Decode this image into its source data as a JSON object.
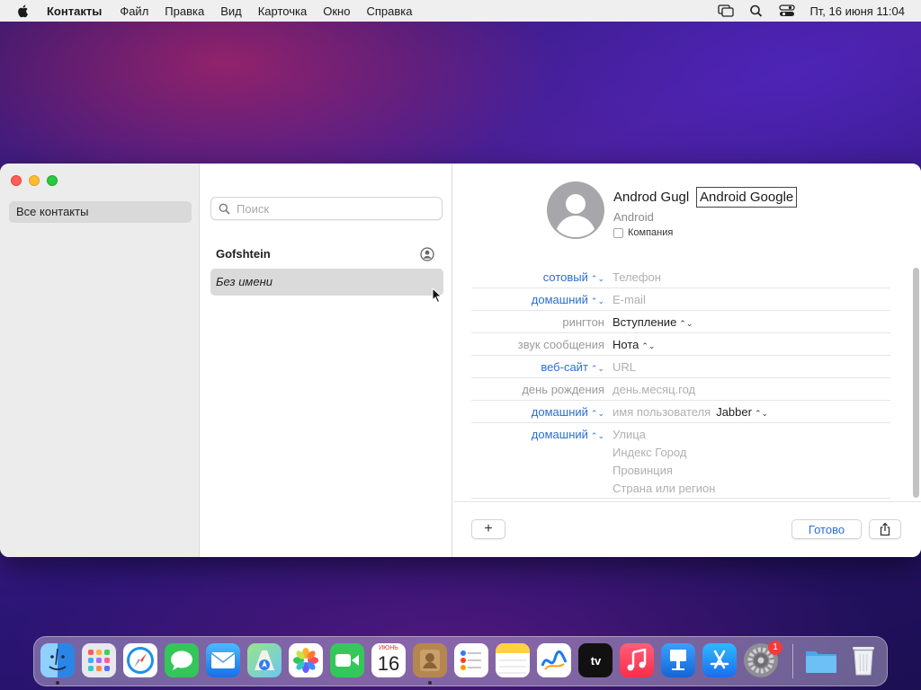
{
  "menubar": {
    "app_name": "Контакты",
    "items": [
      "Файл",
      "Правка",
      "Вид",
      "Карточка",
      "Окно",
      "Справка"
    ],
    "clock": "Пт, 16 июня  11:04"
  },
  "sidebar": {
    "items": [
      {
        "label": "Все контакты"
      }
    ]
  },
  "contact_list": {
    "search_placeholder": "Поиск",
    "rows": [
      {
        "name": "Gofshtein"
      },
      {
        "name": "Без имени"
      }
    ]
  },
  "card": {
    "first_name": "Androd Gugl",
    "name_field_value": "Android Google",
    "company_line": "Android",
    "company_checkbox_label": "Компания",
    "fields": [
      {
        "label": "сотовый",
        "value": "Телефон"
      },
      {
        "label": "домашний",
        "value": "E-mail"
      },
      {
        "label": "рингтон",
        "value": "Вступление"
      },
      {
        "label": "звук сообщения",
        "value": "Нота"
      },
      {
        "label": "веб-сайт",
        "value": "URL"
      },
      {
        "label": "день рождения",
        "value": "день.месяц.год"
      },
      {
        "label": "домашний",
        "value": "имя пользователя",
        "service": "Jabber"
      },
      {
        "label": "домашний",
        "lines": [
          "Улица",
          "Индекс Город",
          "Провинция",
          "Страна или регион"
        ]
      }
    ],
    "add_button": "+",
    "done_button": "Готово"
  },
  "dock": {
    "calendar_month": "ИЮНЬ",
    "calendar_day": "16",
    "tv_label": "tv",
    "settings_badge": "1",
    "apps": [
      "finder",
      "launchpad",
      "safari",
      "messages",
      "mail",
      "maps",
      "photos",
      "facetime",
      "calendar",
      "contacts",
      "reminders",
      "notes",
      "freeform",
      "tv",
      "music",
      "keynote",
      "app-store",
      "system-settings",
      "downloads",
      "trash"
    ]
  }
}
